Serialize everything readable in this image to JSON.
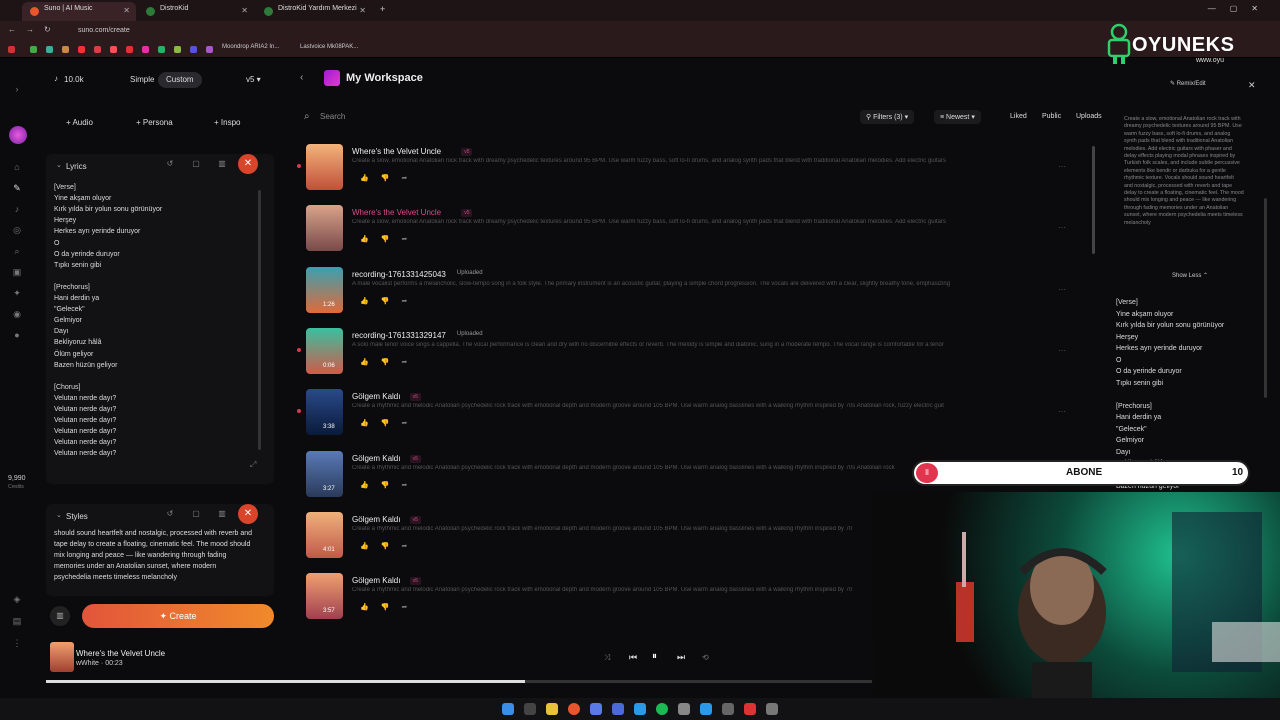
{
  "browser": {
    "tabs": [
      {
        "label": "Suno | AI Music"
      },
      {
        "label": "DistroKid"
      },
      {
        "label": "DistroKid Yardım Merkezi"
      }
    ],
    "url": "suno.com/create",
    "bookmarks": [
      "Moondrop ARIA2 In...",
      "Lastvoice Mk08PAK..."
    ]
  },
  "logo": {
    "text": "OYUNEKS",
    "subtext": "www.oyu"
  },
  "left_rail": {
    "credits": "9,990",
    "credits_label": "Credits"
  },
  "editor": {
    "count": "10.0k",
    "mode_simple": "Simple",
    "mode_custom": "Custom",
    "version": "v5",
    "audio": "+ Audio",
    "persona": "+ Persona",
    "inspo": "+ Inspo",
    "lyrics_title": "Lyrics",
    "lyrics": [
      "[Verse]",
      "Yine akşam oluyor",
      "Kırk yılda bir yolun sonu görünüyor",
      "Herşey",
      "Herkes ayrı yerinde duruyor",
      "O",
      "O da yerinde duruyor",
      "Tıpkı senin gibi",
      "",
      "[Prechorus]",
      "Hani derdin ya",
      "\"Gelecek\"",
      "Gelmiyor",
      "Dayı",
      "Bekliyoruz hâlâ",
      "Ölüm geliyor",
      "Bazen hüzün geliyor",
      "",
      "[Chorus]",
      "Velutan nerde dayı?",
      "Velutan nerde dayı?",
      "Velutan nerde dayı?",
      "Velutan nerde dayı?",
      "Velutan nerde dayı?",
      "Velutan nerde dayı?"
    ],
    "styles_title": "Styles",
    "styles_text": "should sound heartfelt and nostalgic, processed with reverb and tape delay to create a floating, cinematic feel. The mood should mix longing and peace — like wandering through fading memories under an Anatolian sunset, where modern psychedelia meets timeless melancholy",
    "create": "Create"
  },
  "workspace": {
    "title": "My Workspace",
    "search_placeholder": "Search",
    "filters": "Filters (3)",
    "sort": "Newest",
    "liked": "Liked",
    "public": "Public",
    "uploads": "Uploads",
    "songs": [
      {
        "title": "Where's the Velvet Uncle",
        "badge": "v5",
        "desc": "Create a slow, emotional Anatolian rock track with dreamy psychedelic textures around 95 BPM. Use warm fuzzy bass, soft lo-fi drums, and analog synth pads that blend with traditional Anatolian melodies. Add electric guitars",
        "duration": ""
      },
      {
        "title": "Where's the Velvet Uncle",
        "badge": "v5",
        "desc": "Create a slow, emotional Anatolian rock track with dreamy psychedelic textures around 95 BPM. Use warm fuzzy bass, soft lo-fi drums, and analog synth pads that blend with traditional Anatolian melodies. Add electric guitars",
        "duration": ""
      },
      {
        "title": "recording-1761331425043",
        "badge": "Uploaded",
        "desc": "A male vocalist performs a melancholic, slow-tempo song in a folk style. The primary instrument is an acoustic guitar, playing a simple chord progression. The vocals are delivered with a clear, slightly breathy tone, emphasizing",
        "duration": "1:26"
      },
      {
        "title": "recording-1761331329147",
        "badge": "Uploaded",
        "desc": "A solo male tenor voice sings a cappella. The vocal performance is clean and dry with no discernible effects or reverb. The melody is simple and diatonic, sung in a moderate tempo. The vocal range is comfortable for a tenor",
        "duration": "0:06"
      },
      {
        "title": "Gölgem Kaldı",
        "badge": "v5",
        "desc": "Create a rhythmic and melodic Anatolian psychedelic rock track with emotional depth and modern groove around 105 BPM. Use warm analog basslines with a walking rhythm inspired by 70s Anatolian rock, fuzzy electric guit",
        "duration": "3:38"
      },
      {
        "title": "Gölgem Kaldı",
        "badge": "v5",
        "desc": "Create a rhythmic and melodic Anatolian psychedelic rock track with emotional depth and modern groove around 105 BPM. Use warm analog basslines with a walking rhythm inspired by 70s Anatolian rock",
        "duration": "3:27"
      },
      {
        "title": "Gölgem Kaldı",
        "badge": "v5",
        "desc": "Create a rhythmic and melodic Anatolian psychedelic rock track with emotional depth and modern groove around 105 BPM. Use warm analog basslines with a walking rhythm inspired by 70",
        "duration": "4:01"
      },
      {
        "title": "Gölgem Kaldı",
        "badge": "v5",
        "desc": "Create a rhythmic and melodic Anatolian psychedelic rock track with emotional depth and modern groove around 105 BPM. Use warm analog basslines with a walking rhythm inspired by 70",
        "duration": "3:57"
      }
    ]
  },
  "right_panel": {
    "remix": "Remix/Edit",
    "description": "Create a slow, emotional Anatolian rock track with dreamy psychedelic textures around 95 BPM. Use warm fuzzy bass, soft lo-fi drums, and analog synth pads that blend with traditional Anatolian melodies. Add electric guitars with phaser and delay effects playing modal phrases inspired by Turkish folk scales, and include subtle percussive elements like bendir or darbuka for a gentle rhythmic texture. Vocals should sound heartfelt and nostalgic, processed with reverb and tape delay to create a floating, cinematic feel. The mood should mix longing and peace — like wandering through fading memories under an Anatolian sunset, where modern psychedelia meets timeless melancholy",
    "show_less": "Show Less",
    "lyrics": [
      "[Verse]",
      "Yine akşam oluyor",
      "Kırk yılda bir yolun sonu görünüyor",
      "Herşey",
      "Herkes ayrı yerinde duruyor",
      "O",
      "O da yerinde duruyor",
      "Tıpkı senin gibi",
      "",
      "[Prechorus]",
      "Hani derdin ya",
      "\"Gelecek\"",
      "Gelmiyor",
      "Dayı",
      "Bekliyoruz hâlâ",
      "Ölüm geliyor",
      "Bazen hüzün geliyor"
    ]
  },
  "overlay": {
    "subscribe": "ABONE",
    "count": "10"
  },
  "player": {
    "title": "Where's the Velvet Uncle",
    "artist": "wWhite",
    "time": "00:23",
    "progress": 0.58
  },
  "colors": {
    "accent": "#e2553a",
    "pink": "#d94a8c"
  }
}
